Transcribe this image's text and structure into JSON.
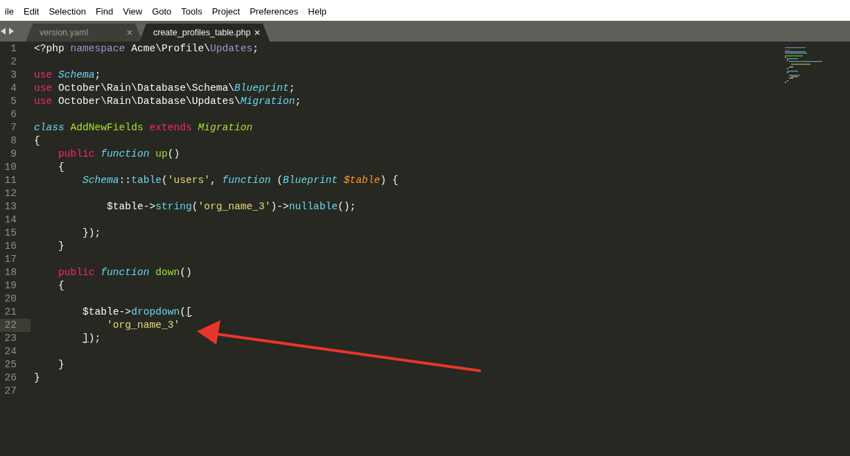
{
  "menu": [
    {
      "label": "ile"
    },
    {
      "label": "Edit"
    },
    {
      "label": "Selection"
    },
    {
      "label": "Find"
    },
    {
      "label": "View"
    },
    {
      "label": "Goto"
    },
    {
      "label": "Tools"
    },
    {
      "label": "Project"
    },
    {
      "label": "Preferences"
    },
    {
      "label": "Help"
    }
  ],
  "tabs": [
    {
      "label": "version.yaml",
      "selected": false
    },
    {
      "label": "create_profiles_table.php",
      "selected": true
    }
  ],
  "editor": {
    "lines": [
      {
        "number": "1",
        "current": false,
        "tokens": [
          {
            "kind": "plain",
            "text": "<?php "
          },
          {
            "kind": "namespace",
            "text": "namespace"
          },
          {
            "kind": "plain",
            "text": " Acme\\Profile\\"
          },
          {
            "kind": "namespace",
            "text": "Updates"
          },
          {
            "kind": "plain",
            "text": ";"
          }
        ]
      },
      {
        "number": "2",
        "current": false
      },
      {
        "number": "3",
        "current": false,
        "tokens": [
          {
            "kind": "keyword",
            "text": "use"
          },
          {
            "kind": "type",
            "text": " Schema"
          },
          {
            "kind": "plain",
            "text": ";"
          }
        ]
      },
      {
        "number": "4",
        "current": false,
        "tokens": [
          {
            "kind": "keyword",
            "text": "use"
          },
          {
            "kind": "plain",
            "text": " October\\Rain\\Database\\Schema\\"
          },
          {
            "kind": "type",
            "text": "Blueprint"
          },
          {
            "kind": "plain",
            "text": ";"
          }
        ]
      },
      {
        "number": "5",
        "current": false,
        "tokens": [
          {
            "kind": "keyword",
            "text": "use"
          },
          {
            "kind": "plain",
            "text": " October\\Rain\\Database\\Updates\\"
          },
          {
            "kind": "type",
            "text": "Migration"
          },
          {
            "kind": "plain",
            "text": ";"
          }
        ]
      },
      {
        "number": "6",
        "current": false
      },
      {
        "number": "7",
        "current": false,
        "tokens": [
          {
            "kind": "storage",
            "text": "class"
          },
          {
            "kind": "entity",
            "text": " AddNewFields"
          },
          {
            "kind": "keyword",
            "text": " extends"
          },
          {
            "kind": "inherited",
            "text": " Migration"
          }
        ]
      },
      {
        "number": "8",
        "current": false,
        "tokens": [
          {
            "kind": "plain",
            "text": "{"
          }
        ]
      },
      {
        "number": "9",
        "current": false,
        "tokens": [
          {
            "kind": "keyword",
            "text": "    public"
          },
          {
            "kind": "storage",
            "text": " function"
          },
          {
            "kind": "entity",
            "text": " up"
          },
          {
            "kind": "plain",
            "text": "()"
          }
        ]
      },
      {
        "number": "10",
        "current": false,
        "tokens": [
          {
            "kind": "plain",
            "text": "    {"
          }
        ]
      },
      {
        "number": "11",
        "current": false,
        "tokens": [
          {
            "kind": "type",
            "text": "        Schema"
          },
          {
            "kind": "plain",
            "text": "::"
          },
          {
            "kind": "support",
            "text": "table"
          },
          {
            "kind": "plain",
            "text": "("
          },
          {
            "kind": "string",
            "text": "'users'"
          },
          {
            "kind": "plain",
            "text": ", "
          },
          {
            "kind": "storage",
            "text": "function"
          },
          {
            "kind": "plain",
            "text": " ("
          },
          {
            "kind": "type",
            "text": "Blueprint"
          },
          {
            "kind": "param",
            "text": " $table"
          },
          {
            "kind": "plain",
            "text": ") {"
          }
        ]
      },
      {
        "number": "12",
        "current": false
      },
      {
        "number": "13",
        "current": false,
        "tokens": [
          {
            "kind": "plain",
            "text": "            $table->"
          },
          {
            "kind": "support",
            "text": "string"
          },
          {
            "kind": "plain",
            "text": "("
          },
          {
            "kind": "string",
            "text": "'org_name_3'"
          },
          {
            "kind": "plain",
            "text": ")->"
          },
          {
            "kind": "support",
            "text": "nullable"
          },
          {
            "kind": "plain",
            "text": "();"
          }
        ]
      },
      {
        "number": "14",
        "current": false
      },
      {
        "number": "15",
        "current": false,
        "tokens": [
          {
            "kind": "plain",
            "text": "        });"
          }
        ]
      },
      {
        "number": "16",
        "current": false,
        "tokens": [
          {
            "kind": "plain",
            "text": "    }"
          }
        ]
      },
      {
        "number": "17",
        "current": false
      },
      {
        "number": "18",
        "current": false,
        "tokens": [
          {
            "kind": "keyword",
            "text": "    public"
          },
          {
            "kind": "storage",
            "text": " function"
          },
          {
            "kind": "entity",
            "text": " down"
          },
          {
            "kind": "plain",
            "text": "()"
          }
        ]
      },
      {
        "number": "19",
        "current": false,
        "tokens": [
          {
            "kind": "plain",
            "text": "    {"
          }
        ]
      },
      {
        "number": "20",
        "current": false
      },
      {
        "number": "21",
        "current": false,
        "tokens": [
          {
            "kind": "plain",
            "text": "        $table->"
          },
          {
            "kind": "support",
            "text": "dropdown"
          },
          {
            "kind": "plain",
            "text": "("
          },
          {
            "kind": "bracket",
            "text": "["
          }
        ]
      },
      {
        "number": "22",
        "current": true,
        "tokens": [
          {
            "kind": "string",
            "text": "            'org_name_3'"
          }
        ]
      },
      {
        "number": "23",
        "current": false,
        "tokens": [
          {
            "kind": "bracket",
            "text": "        ]"
          },
          {
            "kind": "plain",
            "text": ");"
          }
        ]
      },
      {
        "number": "24",
        "current": false
      },
      {
        "number": "25",
        "current": false,
        "tokens": [
          {
            "kind": "plain",
            "text": "    }"
          }
        ]
      },
      {
        "number": "26",
        "current": false,
        "tokens": [
          {
            "kind": "plain",
            "text": "}"
          }
        ]
      },
      {
        "number": "27",
        "current": false
      }
    ]
  }
}
